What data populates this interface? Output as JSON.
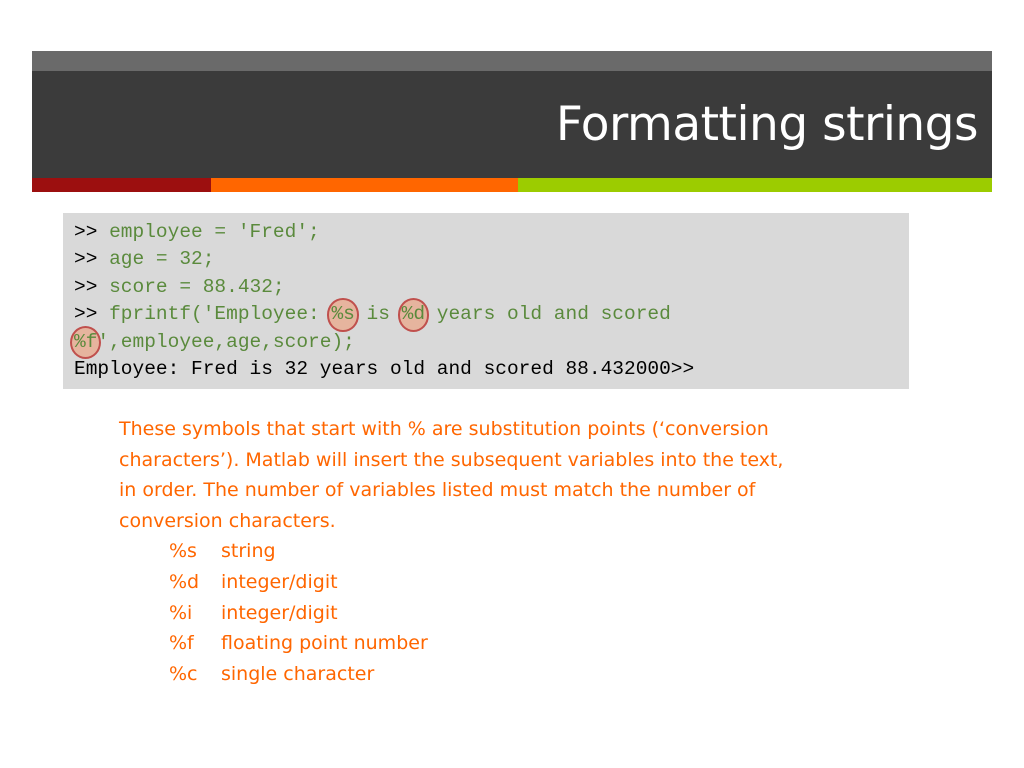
{
  "slide": {
    "title": "Formatting strings"
  },
  "colors": {
    "header_dark": "#3b3b3b",
    "header_strip": "#6a6a6a",
    "accent_red": "#9c0f0f",
    "accent_orange": "#ff6600",
    "accent_green": "#9ccc00",
    "code_bg": "#d9d9d9",
    "code_command": "#5a8a3c",
    "body_text": "#ff6600",
    "highlight_circle": "#c0504d"
  },
  "code": {
    "prompt": ">>",
    "line1": "employee = 'Fred';",
    "line2": "age = 32;",
    "line3": "score = 88.432;",
    "line4_a": "fprintf('Employee: ",
    "line4_spec1": "%s",
    "line4_b": " is ",
    "line4_spec2": "%d",
    "line4_c": " years old and scored",
    "line5_spec": "%f",
    "line5_a": "',employee,age,score);",
    "output": "Employee: Fred is 32 years old and scored 88.432000>>"
  },
  "explanation": {
    "paragraph": "These symbols that start with % are substitution points (‘conversion characters’). Matlab will insert the subsequent variables into the text, in order.  The number of variables listed must match the number of conversion characters.",
    "specifiers": [
      {
        "code": "%s",
        "meaning": "string"
      },
      {
        "code": "%d",
        "meaning": "integer/digit"
      },
      {
        "code": "%i",
        "meaning": "integer/digit"
      },
      {
        "code": "%f",
        "meaning": "floating point number"
      },
      {
        "code": "%c",
        "meaning": "single character"
      }
    ]
  }
}
